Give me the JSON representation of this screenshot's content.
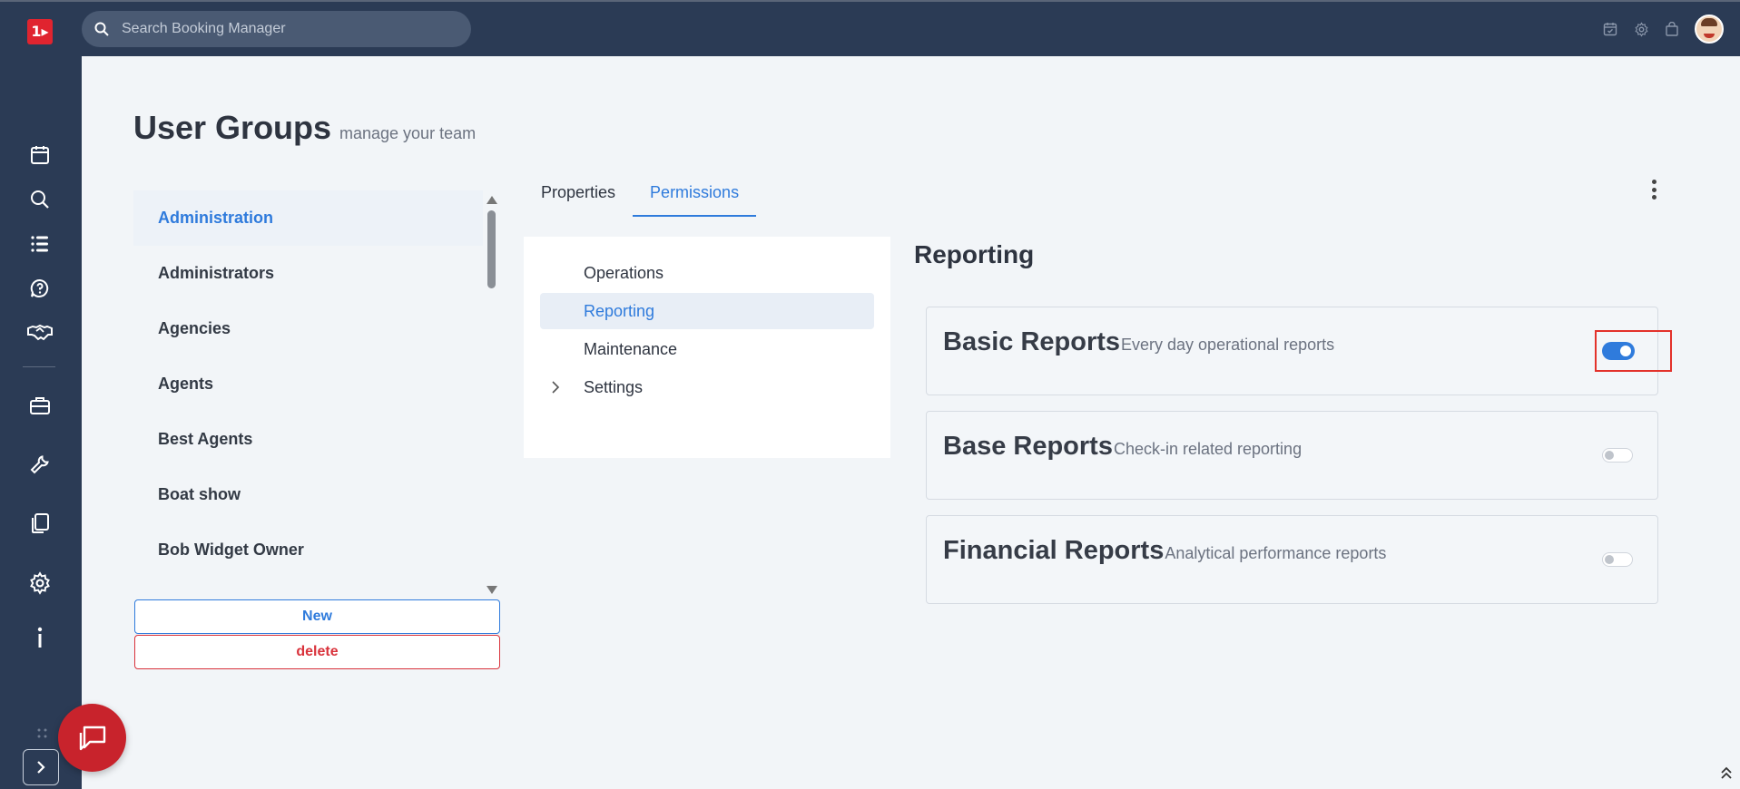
{
  "app": {
    "logo_text": "1▸",
    "search_placeholder": "Search Booking Manager"
  },
  "page": {
    "title": "User Groups",
    "subtitle": "manage your team"
  },
  "groups": {
    "items": [
      {
        "label": "Administration",
        "active": true
      },
      {
        "label": "Administrators",
        "active": false
      },
      {
        "label": "Agencies",
        "active": false
      },
      {
        "label": "Agents",
        "active": false
      },
      {
        "label": "Best Agents",
        "active": false
      },
      {
        "label": "Boat show",
        "active": false
      },
      {
        "label": "Bob Widget Owner",
        "active": false
      }
    ],
    "new_label": "New",
    "delete_label": "delete"
  },
  "tabs": [
    {
      "label": "Properties",
      "active": false
    },
    {
      "label": "Permissions",
      "active": true
    }
  ],
  "tree": [
    {
      "label": "Operations",
      "active": false,
      "expandable": false
    },
    {
      "label": "Reporting",
      "active": true,
      "expandable": false
    },
    {
      "label": "Maintenance",
      "active": false,
      "expandable": false
    },
    {
      "label": "Settings",
      "active": false,
      "expandable": true
    }
  ],
  "section": {
    "title": "Reporting",
    "cards": [
      {
        "title": "Basic Reports",
        "description": "Every day operational reports",
        "enabled": true,
        "highlighted": true
      },
      {
        "title": "Base Reports",
        "description": "Check-in related reporting",
        "enabled": false,
        "highlighted": false
      },
      {
        "title": "Financial Reports",
        "description": "Analytical performance reports",
        "enabled": false,
        "highlighted": false
      }
    ]
  },
  "colors": {
    "sidebar_bg": "#2b3b55",
    "accent": "#2f7bdc",
    "danger": "#d9323b",
    "brand": "#e0242f",
    "highlight": "#e3322b"
  },
  "icons": {
    "top": [
      "calendar-check-icon",
      "gear-icon",
      "shopping-bag-icon",
      "user-avatar"
    ],
    "nav": [
      "calendar-icon",
      "search-icon",
      "list-icon",
      "help-chat-icon",
      "handshake-icon",
      "briefcase-icon",
      "wrench-icon",
      "documents-icon",
      "gear-icon",
      "info-icon"
    ]
  }
}
